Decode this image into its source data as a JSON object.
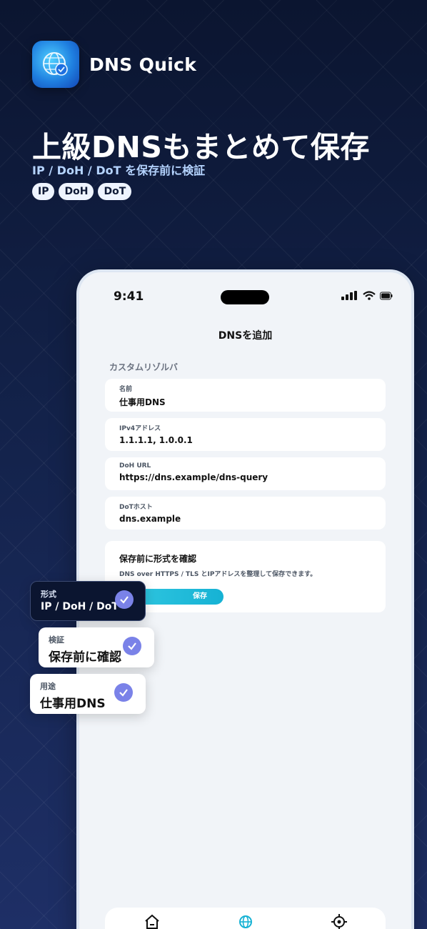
{
  "app": {
    "name": "DNS Quick",
    "icon": "globe-shield-icon"
  },
  "headline": "上級DNSもまとめて保存",
  "subhead": "IP / DoH / DoT を保存前に検証",
  "chips": [
    "IP",
    "DoH",
    "DoT"
  ],
  "phone": {
    "time": "9:41",
    "title": "DNSを追加",
    "section_label": "カスタムリゾルバ",
    "fields": [
      {
        "label": "名前",
        "value": "仕事用DNS"
      },
      {
        "label": "IPv4アドレス",
        "value": "1.1.1.1, 1.0.0.1"
      },
      {
        "label": "DoH URL",
        "value": "https://dns.example/dns-query"
      },
      {
        "label": "DoTホスト",
        "value": "dns.example"
      }
    ],
    "note": {
      "title": "保存前に形式を確認",
      "description": "DNS over HTTPS / TLS とIPアドレスを整理して保存できます。",
      "save_label": "保存"
    },
    "tabs": [
      "home-icon",
      "globe-icon",
      "crosshair-icon"
    ]
  },
  "callouts": [
    {
      "label": "形式",
      "value": "IP / DoH / DoT"
    },
    {
      "label": "検証",
      "value": "保存前に確認"
    },
    {
      "label": "用途",
      "value": "仕事用DNS"
    }
  ],
  "colors": {
    "accent": "#16b2d4",
    "check": "#7a82e8",
    "background": "#0b1530"
  }
}
